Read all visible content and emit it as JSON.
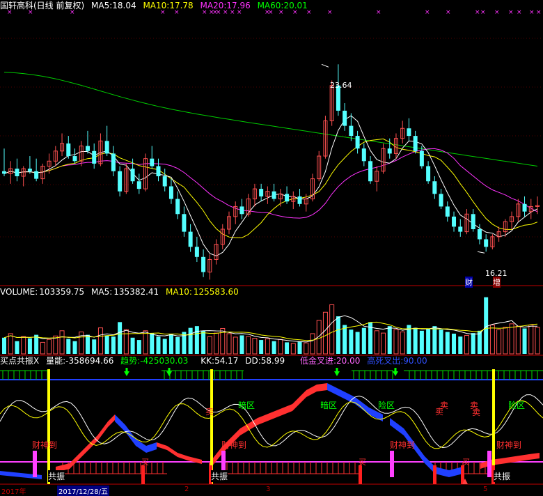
{
  "colors": {
    "up": "#ff5050",
    "down": "#54ffff",
    "ma5": "#ffffff",
    "ma10": "#ffff00",
    "ma20": "#ff33ff",
    "ma60": "#00cc00",
    "divider": "#c00000",
    "blue_line": "#2040ff",
    "magenta_line": "#ff40ff"
  },
  "price_panel": {
    "stock": "国轩高科(日线 前复权)",
    "ma5_label": "MA5:",
    "ma5_value": "18.04",
    "ma10_label": "MA10:",
    "ma10_value": "17.78",
    "ma20_label": "MA20:",
    "ma20_value": "17.96",
    "ma60_label": "MA60:",
    "ma60_value": "20.01",
    "high_label": "23.64",
    "low_label": "16.21",
    "marker_cai": "财",
    "marker_zeng": "增",
    "candles": [
      [
        19.4,
        20.3,
        19.2,
        19.3
      ],
      [
        19.3,
        19.8,
        18.9,
        19.5
      ],
      [
        19.5,
        19.9,
        19.0,
        19.2
      ],
      [
        19.2,
        19.6,
        18.8,
        19.5
      ],
      [
        19.5,
        20.0,
        19.3,
        19.4
      ],
      [
        19.4,
        19.9,
        19.0,
        19.1
      ],
      [
        19.1,
        19.7,
        18.9,
        19.6
      ],
      [
        19.6,
        20.1,
        19.3,
        19.8
      ],
      [
        19.8,
        20.4,
        19.6,
        20.2
      ],
      [
        20.2,
        20.9,
        20.0,
        20.5
      ],
      [
        20.5,
        20.8,
        19.9,
        20.0
      ],
      [
        20.0,
        20.3,
        19.7,
        19.8
      ],
      [
        19.8,
        20.6,
        19.6,
        20.4
      ],
      [
        20.4,
        21.0,
        20.1,
        20.2
      ],
      [
        20.2,
        20.5,
        19.5,
        19.7
      ],
      [
        19.7,
        20.9,
        19.6,
        20.6
      ],
      [
        20.6,
        21.2,
        20.0,
        20.1
      ],
      [
        20.1,
        20.4,
        19.2,
        19.4
      ],
      [
        19.4,
        19.6,
        18.4,
        18.6
      ],
      [
        18.6,
        19.7,
        18.5,
        19.5
      ],
      [
        19.5,
        19.9,
        18.9,
        19.0
      ],
      [
        19.0,
        19.3,
        18.5,
        18.7
      ],
      [
        18.7,
        20.1,
        18.6,
        19.9
      ],
      [
        19.9,
        20.4,
        19.5,
        19.6
      ],
      [
        19.6,
        19.9,
        19.0,
        19.2
      ],
      [
        19.2,
        19.5,
        18.6,
        18.8
      ],
      [
        18.8,
        19.1,
        18.1,
        18.3
      ],
      [
        18.3,
        18.6,
        17.5,
        17.7
      ],
      [
        17.7,
        18.0,
        16.8,
        17.0
      ],
      [
        17.0,
        17.3,
        16.2,
        16.4
      ],
      [
        16.4,
        16.8,
        15.8,
        16.0
      ],
      [
        16.0,
        16.3,
        15.2,
        15.4
      ],
      [
        15.4,
        16.1,
        15.1,
        15.9
      ],
      [
        15.9,
        16.7,
        15.7,
        16.5
      ],
      [
        16.5,
        17.3,
        16.3,
        17.1
      ],
      [
        17.1,
        17.8,
        16.9,
        17.6
      ],
      [
        17.6,
        18.2,
        17.3,
        18.0
      ],
      [
        18.0,
        18.3,
        17.5,
        17.7
      ],
      [
        17.7,
        18.5,
        17.6,
        18.3
      ],
      [
        18.3,
        18.9,
        18.0,
        18.7
      ],
      [
        18.7,
        18.9,
        18.2,
        18.4
      ],
      [
        18.4,
        18.8,
        18.1,
        18.6
      ],
      [
        18.6,
        18.9,
        18.2,
        18.3
      ],
      [
        18.3,
        18.7,
        18.0,
        18.5
      ],
      [
        18.5,
        18.8,
        18.1,
        18.2
      ],
      [
        18.2,
        18.6,
        17.9,
        18.4
      ],
      [
        18.4,
        18.7,
        18.0,
        18.1
      ],
      [
        18.1,
        18.5,
        17.8,
        18.3
      ],
      [
        18.3,
        19.3,
        18.2,
        19.1
      ],
      [
        19.1,
        20.2,
        19.0,
        20.0
      ],
      [
        20.0,
        21.6,
        19.9,
        21.4
      ],
      [
        21.4,
        23.0,
        21.2,
        22.8
      ],
      [
        22.8,
        23.64,
        21.6,
        21.8
      ],
      [
        21.8,
        22.1,
        21.0,
        21.2
      ],
      [
        21.2,
        21.7,
        20.6,
        20.8
      ],
      [
        20.8,
        21.0,
        20.1,
        20.3
      ],
      [
        20.3,
        20.5,
        19.6,
        19.8
      ],
      [
        19.8,
        20.0,
        18.9,
        19.0
      ],
      [
        19.0,
        19.6,
        18.6,
        19.4
      ],
      [
        19.4,
        20.5,
        19.3,
        20.3
      ],
      [
        20.3,
        20.7,
        19.9,
        20.1
      ],
      [
        20.1,
        20.9,
        19.9,
        20.7
      ],
      [
        20.7,
        21.4,
        20.5,
        21.1
      ],
      [
        21.1,
        21.5,
        20.6,
        20.8
      ],
      [
        20.8,
        21.0,
        20.1,
        20.2
      ],
      [
        20.2,
        20.4,
        19.5,
        19.6
      ],
      [
        19.6,
        19.8,
        18.9,
        19.0
      ],
      [
        19.0,
        19.2,
        18.3,
        18.5
      ],
      [
        18.5,
        18.7,
        17.9,
        18.0
      ],
      [
        18.0,
        18.2,
        17.4,
        17.6
      ],
      [
        17.6,
        17.8,
        17.0,
        17.2
      ],
      [
        17.2,
        17.5,
        16.8,
        17.0
      ],
      [
        17.0,
        17.9,
        16.9,
        17.7
      ],
      [
        17.7,
        17.9,
        17.0,
        17.1
      ],
      [
        17.1,
        17.3,
        16.5,
        16.7
      ],
      [
        16.7,
        16.9,
        16.21,
        16.4
      ],
      [
        16.4,
        16.9,
        16.3,
        16.8
      ],
      [
        16.8,
        17.2,
        16.6,
        17.0
      ],
      [
        17.0,
        17.5,
        16.8,
        17.4
      ],
      [
        17.4,
        17.8,
        17.1,
        17.6
      ],
      [
        17.6,
        18.3,
        17.4,
        18.1
      ],
      [
        18.1,
        18.4,
        17.6,
        17.8
      ],
      [
        17.8,
        18.3,
        17.5,
        18.0
      ],
      [
        18.0,
        18.4,
        17.7,
        18.04
      ]
    ]
  },
  "volume_panel": {
    "title": "VOLUME:",
    "value": "103359.75",
    "ma5_label": "MA5:",
    "ma5_value": "135382.41",
    "ma10_label": "MA10:",
    "ma10_value": "125583.60",
    "bars": [
      0.28,
      0.35,
      0.22,
      0.3,
      0.27,
      0.33,
      0.2,
      0.25,
      0.31,
      0.4,
      0.26,
      0.22,
      0.38,
      0.33,
      0.25,
      0.45,
      0.32,
      0.3,
      0.55,
      0.42,
      0.28,
      0.24,
      0.4,
      0.36,
      0.3,
      0.26,
      0.34,
      0.29,
      0.38,
      0.45,
      0.48,
      0.4,
      0.3,
      0.36,
      0.44,
      0.35,
      0.29,
      0.32,
      0.3,
      0.27,
      0.24,
      0.26,
      0.22,
      0.25,
      0.2,
      0.18,
      0.21,
      0.19,
      0.35,
      0.58,
      0.72,
      0.85,
      0.65,
      0.5,
      0.42,
      0.38,
      0.45,
      0.55,
      0.4,
      0.36,
      0.48,
      0.42,
      0.38,
      0.5,
      0.45,
      0.4,
      0.43,
      0.48,
      0.42,
      0.38,
      0.35,
      0.3,
      0.32,
      0.36,
      0.4,
      0.98,
      0.5,
      0.42,
      0.46,
      0.52,
      0.48,
      0.44,
      0.5,
      0.46
    ]
  },
  "indicator_panel": {
    "title": "买点共振X",
    "energy_label": "量能:",
    "energy_value": "-358694.66",
    "trend_label": "趋势:",
    "trend_value": "-425030.03",
    "kk_label": "KK:",
    "kk_value": "54.17",
    "dd_label": "DD:",
    "dd_value": "58.99",
    "golden_label": "低金叉进:",
    "golden_value": "20.00",
    "dead_label": "高死叉出:",
    "dead_value": "90.00",
    "zones": [
      {
        "text": "暗区",
        "color": "#00ff00"
      },
      {
        "text": "暗区",
        "color": "#00ff00"
      },
      {
        "text": "险区",
        "color": "#00ff00"
      },
      {
        "text": "险区",
        "color": "#00ff00"
      },
      {
        "text": "卖",
        "color": "#ff3030"
      },
      {
        "text": "卖",
        "color": "#ff3030"
      },
      {
        "text": "卖",
        "color": "#ff3030"
      },
      {
        "text": "卖",
        "color": "#ff3030"
      },
      {
        "text": "卖",
        "color": "#ff3030"
      }
    ],
    "signals": [
      "财神到",
      "财神到",
      "财神到",
      "财神到"
    ],
    "buy_marks": [
      "买",
      "买",
      "买"
    ],
    "resonance": [
      "共振",
      "共振",
      "共振"
    ]
  },
  "date_axis": {
    "left_year": "2017年",
    "cursor_date": "2017/12/28/五",
    "ticks": [
      "2",
      "3",
      "5"
    ]
  }
}
